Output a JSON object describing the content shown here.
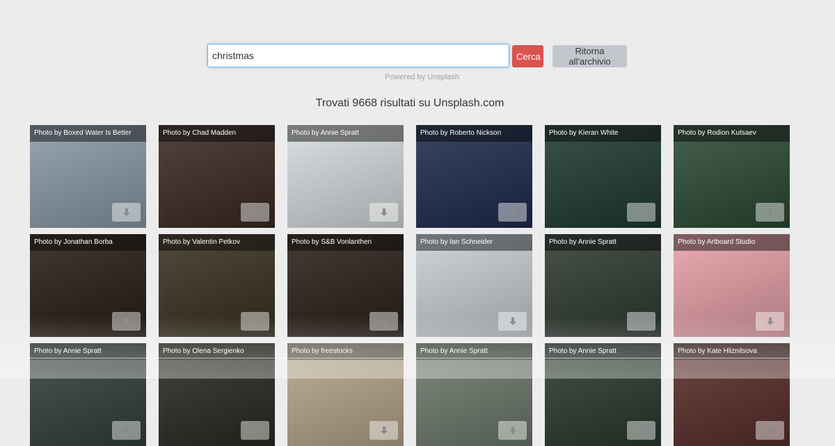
{
  "search": {
    "value": "christmas",
    "placeholder": ""
  },
  "buttons": {
    "search_label": "Cerca",
    "back_label": "Ritorna all'archivio"
  },
  "powered_by": "Powered by Unsplash",
  "results_text": "Trovati 9668 risultati su Unsplash.com",
  "photos": [
    {
      "caption": "Photo by Boxed Water Is Better",
      "bg": "#8a9aa8"
    },
    {
      "caption": "Photo by Chad Madden",
      "bg": "#3b2a22"
    },
    {
      "caption": "Photo by Annie Spratt",
      "bg": "#d8dcde"
    },
    {
      "caption": "Photo by Roberto Nickson",
      "bg": "#1d2c4f"
    },
    {
      "caption": "Photo by Kieran White",
      "bg": "#1f3a33"
    },
    {
      "caption": "Photo by Rodion Kutsaev",
      "bg": "#2c4a36"
    },
    {
      "caption": "Photo by Jonathan Borba",
      "bg": "#2a1e16"
    },
    {
      "caption": "Photo by Valentin Petkov",
      "bg": "#3a3220"
    },
    {
      "caption": "Photo by S&B Vonlanthen",
      "bg": "#2c211a"
    },
    {
      "caption": "Photo by Ian Schneider",
      "bg": "#c9d1d6"
    },
    {
      "caption": "Photo by Annie Spratt",
      "bg": "#2f3a32"
    },
    {
      "caption": "Photo by Artboard Studio",
      "bg": "#e7a1a8"
    },
    {
      "caption": "Photo by Annie Spratt",
      "bg": "#33403c"
    },
    {
      "caption": "Photo by Olena Sergienko",
      "bg": "#2a2b22"
    },
    {
      "caption": "Photo by freestocks",
      "bg": "#b7a78a"
    },
    {
      "caption": "Photo by Annie Spratt",
      "bg": "#6e7a6c"
    },
    {
      "caption": "Photo by Annie Spratt",
      "bg": "#2a3a2e"
    },
    {
      "caption": "Photo by Kate Hliznitsova",
      "bg": "#5a2e2a"
    }
  ],
  "icons": {
    "download": "download-icon"
  },
  "colors": {
    "search_button": "#d9534f",
    "back_button": "#c3c7cd",
    "input_focus_border": "#66afe9"
  }
}
